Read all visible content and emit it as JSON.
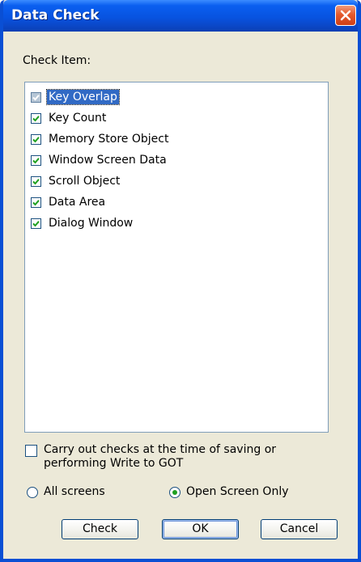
{
  "window": {
    "title": "Data Check"
  },
  "check_item_label": "Check Item:",
  "items": [
    {
      "label": "Key Overlap",
      "checked": true,
      "selected": true
    },
    {
      "label": "Key Count",
      "checked": true
    },
    {
      "label": "Memory Store Object",
      "checked": true
    },
    {
      "label": "Window Screen Data",
      "checked": true
    },
    {
      "label": "Scroll Object",
      "checked": true
    },
    {
      "label": "Data Area",
      "checked": true
    },
    {
      "label": "Dialog Window",
      "checked": true
    }
  ],
  "save_check": {
    "line1": "Carry out checks at the time of saving or",
    "line2": "performing Write to GOT",
    "checked": false
  },
  "scope": {
    "options": [
      "All screens",
      "Open Screen Only"
    ],
    "selected": "Open Screen Only"
  },
  "buttons": {
    "check": "Check",
    "ok": "OK",
    "cancel": "Cancel"
  },
  "colors": {
    "title_bar": "#0a5ff0",
    "dialog_bg": "#ece9d8",
    "selection": "#316ac5",
    "check_mark": "#21a121"
  }
}
